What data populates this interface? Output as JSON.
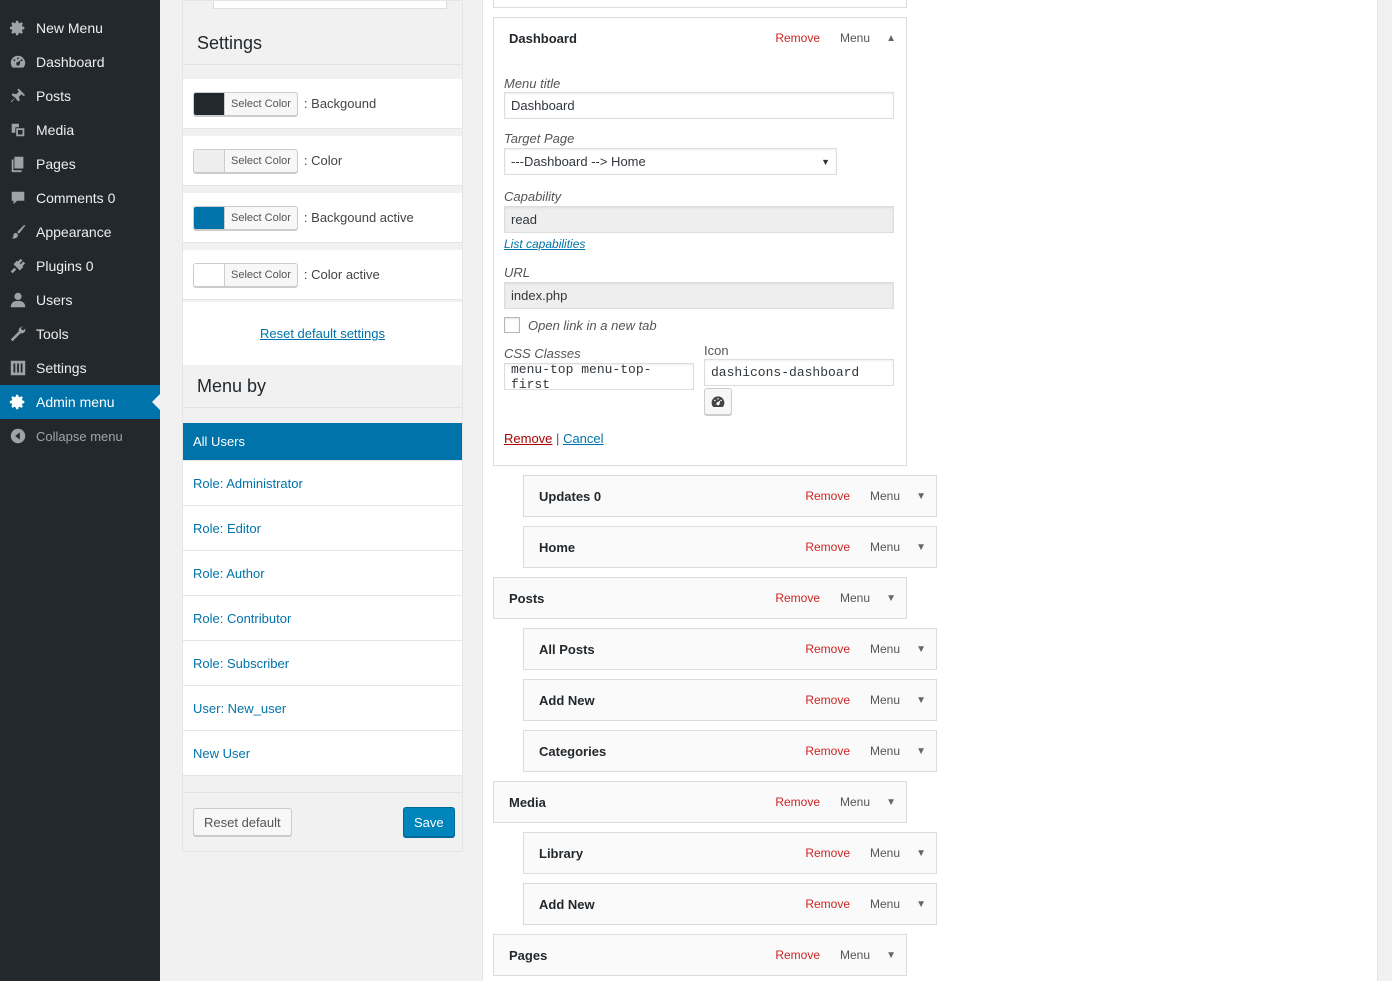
{
  "admin_menu": {
    "items": [
      {
        "label": "New Menu",
        "icon": "gear-icon"
      },
      {
        "label": "Dashboard",
        "icon": "dashboard-icon"
      },
      {
        "label": "Posts",
        "icon": "pin-icon"
      },
      {
        "label": "Media",
        "icon": "media-icon"
      },
      {
        "label": "Pages",
        "icon": "pages-icon"
      },
      {
        "label": "Comments 0",
        "icon": "comment-icon"
      },
      {
        "label": "Appearance",
        "icon": "brush-icon"
      },
      {
        "label": "Plugins 0",
        "icon": "plugin-icon"
      },
      {
        "label": "Users",
        "icon": "user-icon"
      },
      {
        "label": "Tools",
        "icon": "wrench-icon"
      },
      {
        "label": "Settings",
        "icon": "sliders-icon"
      },
      {
        "label": "Admin menu",
        "icon": "gear-icon",
        "current": true
      }
    ],
    "collapse_label": "Collapse menu"
  },
  "settings": {
    "title": "Settings",
    "select_color_label": "Select Color",
    "colors": [
      {
        "swatch": "#23282d",
        "label": ": Backgound"
      },
      {
        "swatch": "#eeeeee",
        "label": ": Color"
      },
      {
        "swatch": "#0073aa",
        "label": ": Backgound active"
      },
      {
        "swatch": "#ffffff",
        "label": ": Color active"
      }
    ],
    "reset_link": "Reset default settings"
  },
  "menu_by": {
    "title": "Menu by",
    "items": [
      "All Users",
      "Role: Administrator",
      "Role: Editor",
      "Role: Author",
      "Role: Contributor",
      "Role: Subscriber",
      "User: New_user",
      "New User"
    ],
    "reset_button": "Reset default",
    "save_button": "Save"
  },
  "editor": {
    "open_item": {
      "title": "Dashboard",
      "remove": "Remove",
      "type": "Menu",
      "menu_title_label": "Menu title",
      "menu_title_value": "Dashboard",
      "target_page_label": "Target Page",
      "target_page_value": "---Dashboard --> Home",
      "capability_label": "Capability",
      "capability_value": "read",
      "list_capabilities": "List capabilities",
      "url_label": "URL",
      "url_value": "index.php",
      "new_tab_label": "Open link in a new tab",
      "css_label": "CSS Classes",
      "css_value": "menu-top menu-top-first",
      "icon_label": "Icon",
      "icon_value": "dashicons-dashboard",
      "remove_link": "Remove",
      "separator": "|",
      "cancel_link": "Cancel"
    },
    "items": [
      {
        "title": "Updates 0",
        "remove": "Remove",
        "type": "Menu",
        "sub": true
      },
      {
        "title": "Home",
        "remove": "Remove",
        "type": "Menu",
        "sub": true
      },
      {
        "title": "Posts",
        "remove": "Remove",
        "type": "Menu",
        "sub": false
      },
      {
        "title": "All Posts",
        "remove": "Remove",
        "type": "Menu",
        "sub": true
      },
      {
        "title": "Add New",
        "remove": "Remove",
        "type": "Menu",
        "sub": true
      },
      {
        "title": "Categories",
        "remove": "Remove",
        "type": "Menu",
        "sub": true
      },
      {
        "title": "Media",
        "remove": "Remove",
        "type": "Menu",
        "sub": false
      },
      {
        "title": "Library",
        "remove": "Remove",
        "type": "Menu",
        "sub": true
      },
      {
        "title": "Add New",
        "remove": "Remove",
        "type": "Menu",
        "sub": true
      },
      {
        "title": "Pages",
        "remove": "Remove",
        "type": "Menu",
        "sub": false
      }
    ]
  }
}
